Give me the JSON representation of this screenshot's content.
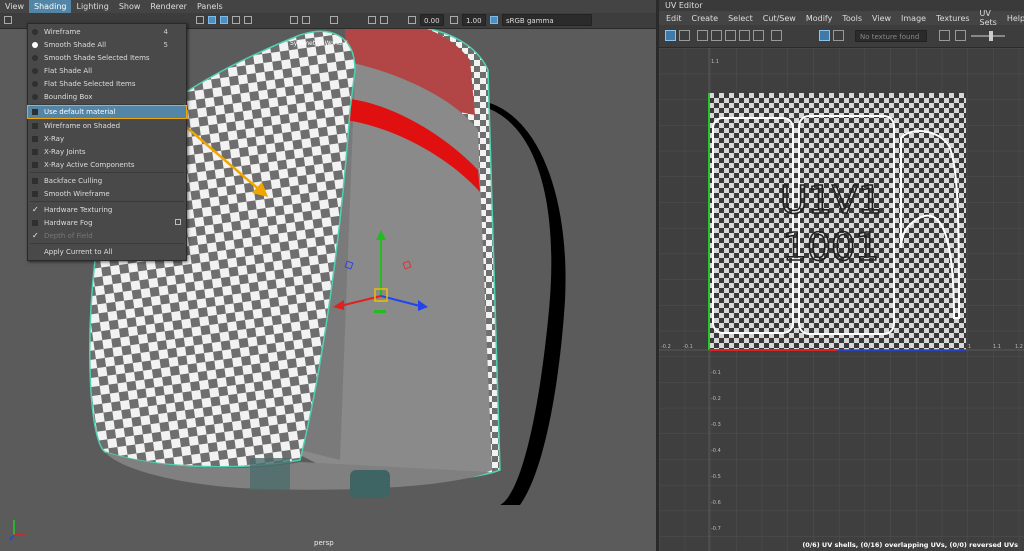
{
  "viewport": {
    "menus": [
      "View",
      "Shading",
      "Lighting",
      "Show",
      "Renderer",
      "Panels"
    ],
    "active_menu": "Shading",
    "toolbar": {
      "value_a": "0.00",
      "value_b": "1.00",
      "colorspace": "sRGB gamma"
    },
    "symmetry_label": "Symmetry: World X",
    "camera_label": "persp",
    "colors": {
      "menu_highlight": "#5285a6",
      "annotation": "#f0a500"
    }
  },
  "shading_menu": {
    "items": [
      {
        "label": "Wireframe",
        "marker": "radio",
        "hint": "4"
      },
      {
        "label": "Smooth Shade All",
        "marker": "radio-selected",
        "hint": "5"
      },
      {
        "label": "Smooth Shade Selected Items",
        "marker": "radio"
      },
      {
        "label": "Flat Shade All",
        "marker": "radio"
      },
      {
        "label": "Flat Shade Selected Items",
        "marker": "radio"
      },
      {
        "label": "Bounding Box",
        "marker": "radio"
      },
      {
        "label": "Use default material",
        "marker": "box",
        "highlighted": true
      },
      {
        "label": "Wireframe on Shaded",
        "marker": "box"
      },
      {
        "label": "X-Ray",
        "marker": "box"
      },
      {
        "label": "X-Ray Joints",
        "marker": "box"
      },
      {
        "label": "X-Ray Active Components",
        "marker": "box"
      },
      {
        "label": "Backface Culling",
        "marker": "box"
      },
      {
        "label": "Smooth Wireframe",
        "marker": "box"
      },
      {
        "label": "Hardware Texturing",
        "marker": "check"
      },
      {
        "label": "Hardware Fog",
        "marker": "box",
        "option_box": true
      },
      {
        "label": "Depth of Field",
        "marker": "check",
        "disabled": true
      },
      {
        "label": "Apply Current to All",
        "marker": "none"
      }
    ]
  },
  "uv_editor": {
    "title": "UV Editor",
    "menus": [
      "Edit",
      "Create",
      "Select",
      "Cut/Sew",
      "Modify",
      "Tools",
      "View",
      "Image",
      "Textures",
      "UV Sets",
      "Help"
    ],
    "texture_field_placeholder": "No texture found",
    "tile_label_1": "U1V1",
    "tile_label_2": "1001",
    "axis_labels": {
      "top": "1.1",
      "u_neg2": "-0.2",
      "u_neg1": "-0.1",
      "u_one": "1",
      "u_1_1": "1.1",
      "u_1_2": "1.2",
      "v_neg": [
        "-0.1",
        "-0.2",
        "-0.3",
        "-0.4",
        "-0.5",
        "-0.6",
        "-0.7"
      ]
    },
    "status": "(0/6) UV shells, (0/16) overlapping UVs, (0/0) reversed UVs"
  }
}
